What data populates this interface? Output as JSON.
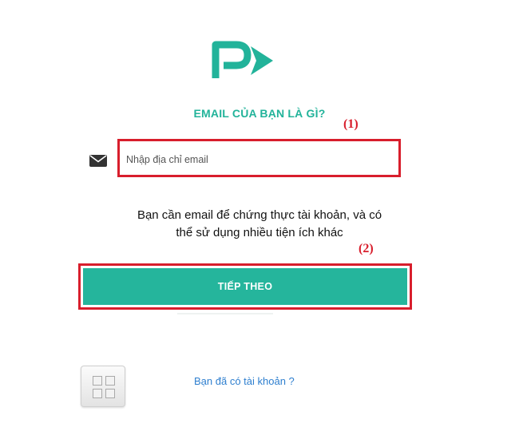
{
  "brand": {
    "logo_icon": "play-brand-logo",
    "color": "#22b39a"
  },
  "heading": "EMAIL CỦA BẠN LÀ GÌ?",
  "annotations": {
    "marker_1": "(1)",
    "marker_2": "(2)",
    "color": "#d81e2c"
  },
  "email": {
    "icon": "envelope-icon",
    "placeholder": "Nhập địa chỉ email",
    "value": ""
  },
  "description": {
    "line1": "Bạn cần email để chứng thực tài khoản, và có",
    "line2": "thể sử dụng nhiều tiện ích khác"
  },
  "cta": {
    "label": "TIẾP THEO",
    "color": "#25b59c"
  },
  "apps_button": {
    "icon": "grid-icon"
  },
  "login_link": "Bạn đã có tài khoản ?"
}
